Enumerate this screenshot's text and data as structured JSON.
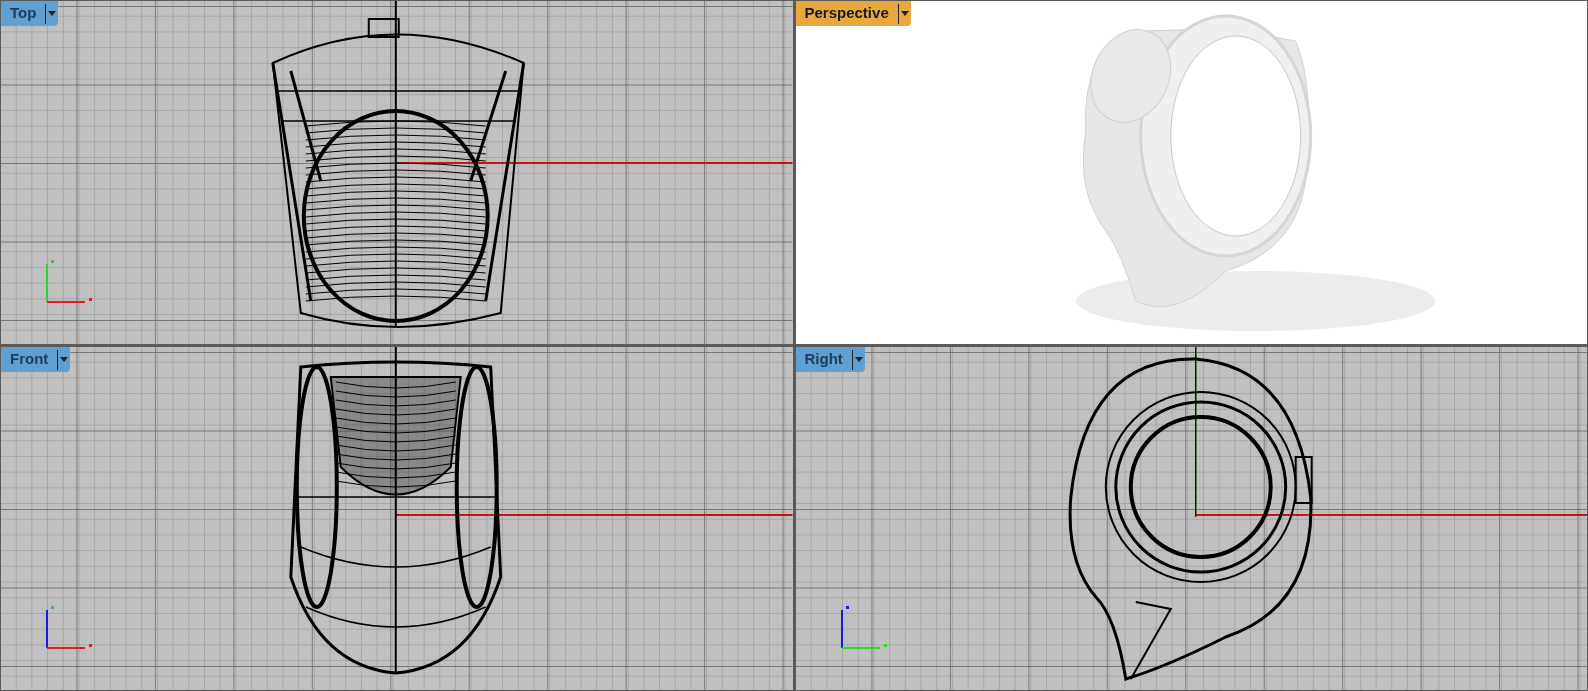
{
  "viewports": [
    {
      "title": "Top",
      "selected": false,
      "kind": "top"
    },
    {
      "title": "Perspective",
      "selected": true,
      "kind": "perspective"
    },
    {
      "title": "Front",
      "selected": false,
      "kind": "front"
    },
    {
      "title": "Right",
      "selected": false,
      "kind": "right"
    }
  ]
}
